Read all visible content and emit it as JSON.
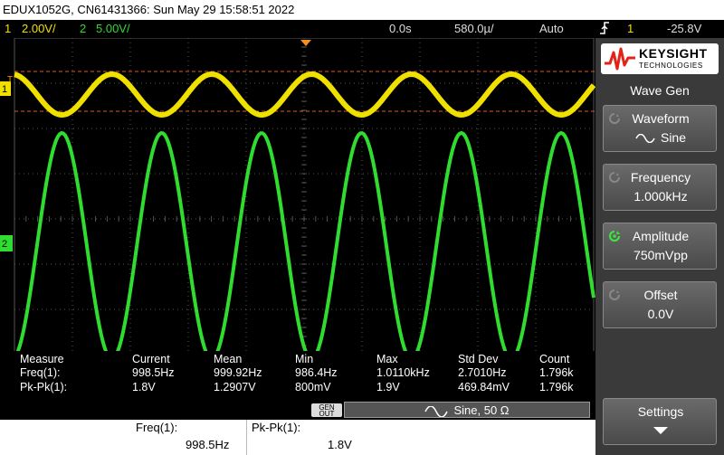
{
  "title_bar": {
    "text": "EDUX1052G, CN61431366: Sun May 29 15:58:51 2022"
  },
  "status": {
    "ch1_num": "1",
    "ch1_scale": "2.00V/",
    "ch2_num": "2",
    "ch2_scale": "5.00V/",
    "delay": "0.0s",
    "timebase": "580.0µ/",
    "trigger_mode": "Auto",
    "trigger_icon": "trigger-edge-icon",
    "trigger_channel": "1",
    "trigger_level": "-25.8V"
  },
  "markers": {
    "ch1": "1",
    "ch2": "2",
    "trigger": "T"
  },
  "measurements": {
    "headers": [
      "Measure",
      "Current",
      "Mean",
      "Min",
      "Max",
      "Std Dev",
      "Count"
    ],
    "rows": [
      [
        "Freq(1):",
        "998.5Hz",
        "999.92Hz",
        "986.4Hz",
        "1.0110kHz",
        "2.7010Hz",
        "1.796k"
      ],
      [
        "Pk-Pk(1):",
        "1.8V",
        "1.2907V",
        "800mV",
        "1.9V",
        "469.84mV",
        "1.796k"
      ]
    ]
  },
  "gen": {
    "out_line1": "GEN",
    "out_line2": "OUT",
    "wave_icon": "sine-wave-icon",
    "summary": "Sine, 50 Ω"
  },
  "results": {
    "freq_label": "Freq(1):",
    "freq_value": "998.5Hz",
    "pk_label": "Pk-Pk(1):",
    "pk_value": "1.8V"
  },
  "panel": {
    "brand": "KEYSIGHT",
    "brand_sub": "TECHNOLOGIES",
    "title": "Wave Gen",
    "softkeys": [
      {
        "label": "Waveform",
        "value": "Sine",
        "value_icon": "sine-wave-icon"
      },
      {
        "label": "Frequency",
        "value": "1.000kHz"
      },
      {
        "label": "Amplitude",
        "value": "750mVpp",
        "active": true
      },
      {
        "label": "Offset",
        "value": "0.0V"
      }
    ],
    "settings": "Settings"
  },
  "colors": {
    "ch1": "#f0e000",
    "ch2": "#2fdc2f",
    "grid": "#555555",
    "panel": "#3a3a3a",
    "keysight_red": "#e2231a"
  },
  "waveforms": {
    "period_divisions": 1.724,
    "ch1": {
      "amplitude_divisions": 0.45,
      "center_division": 1.25
    },
    "ch2": {
      "amplitude_divisions": 2.5,
      "center_division": 4.6
    }
  }
}
